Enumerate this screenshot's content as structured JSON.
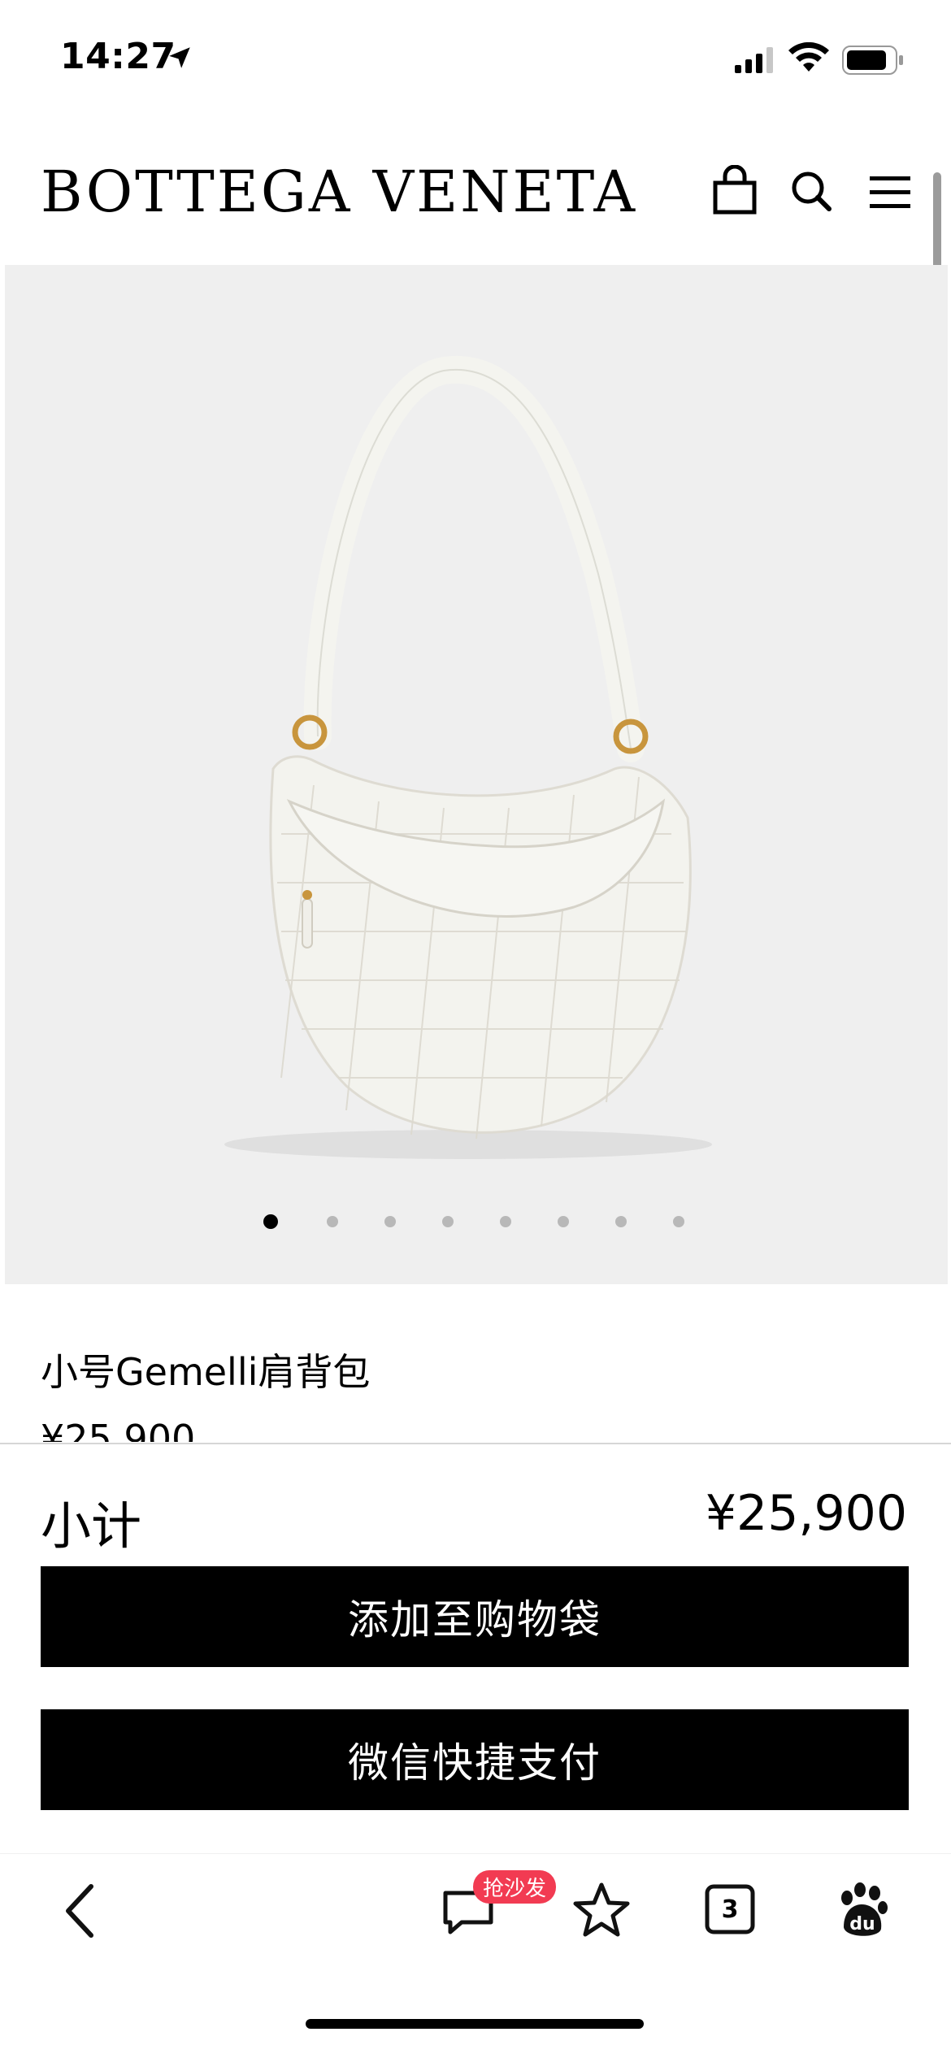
{
  "status_bar": {
    "time": "14:27"
  },
  "header": {
    "brand": "BOTTEGA VENETA"
  },
  "gallery": {
    "total_images": 8,
    "active_index": 0
  },
  "product": {
    "name": "小号Gemelli肩背包",
    "price": "¥25,900"
  },
  "checkout": {
    "subtotal_label": "小计",
    "subtotal_value": "¥25,900",
    "add_to_bag_label": "添加至购物袋",
    "wechat_pay_label": "微信快捷支付"
  },
  "toolbar": {
    "promo_badge": "抢沙发",
    "tab_count": "3"
  },
  "colors": {
    "accent": "#000000",
    "badge": "#f23b52",
    "gallery_bg": "#efefef"
  },
  "icons": [
    "location-arrow-icon",
    "signal-icon",
    "wifi-icon",
    "battery-icon",
    "shopping-bag-icon",
    "search-icon",
    "menu-icon",
    "back-icon",
    "comment-icon",
    "star-icon",
    "tabs-icon",
    "baidu-paw-icon"
  ]
}
